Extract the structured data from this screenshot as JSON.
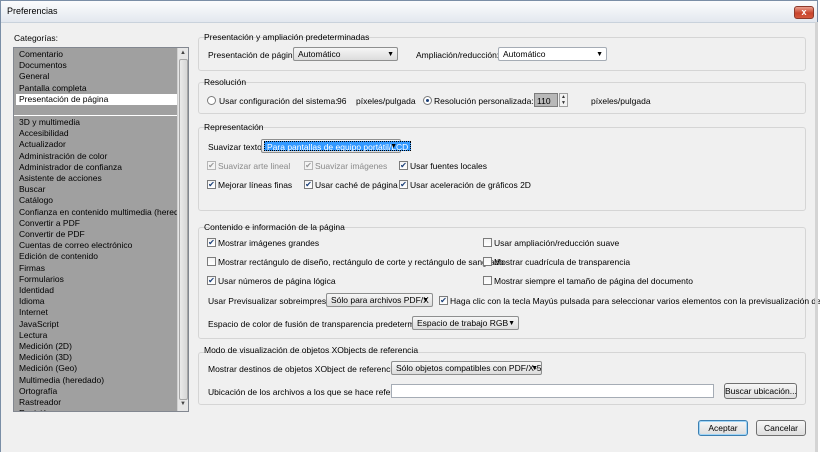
{
  "window": {
    "title": "Preferencias",
    "close_glyph": "x"
  },
  "categories": {
    "label": "Categorías:",
    "group1": [
      "Comentario",
      "Documentos",
      "General",
      "Pantalla completa",
      "Presentación de página"
    ],
    "selected": "Presentación de página",
    "group2": [
      "3D y multimedia",
      "Accesibilidad",
      "Actualizador",
      "Administración de color",
      "Administrador de confianza",
      "Asistente de acciones",
      "Buscar",
      "Catálogo",
      "Confianza en contenido multimedia (heredado)",
      "Convertir a PDF",
      "Convertir de PDF",
      "Cuentas de correo electrónico",
      "Edición de contenido",
      "Firmas",
      "Formularios",
      "Identidad",
      "Idioma",
      "Internet",
      "JavaScript",
      "Lectura",
      "Medición (2D)",
      "Medición (3D)",
      "Medición (Geo)",
      "Multimedia (heredado)",
      "Ortografía",
      "Rastreador",
      "Revisión"
    ]
  },
  "layout_section": {
    "title": "Presentación y ampliación predeterminadas",
    "page_layout_label": "Presentación de página:",
    "page_layout_value": "Automático",
    "zoom_label": "Ampliación/reducción:",
    "zoom_value": "Automático"
  },
  "resolution": {
    "title": "Resolución",
    "system_label": "Usar configuración del sistema:",
    "system_value": "96",
    "system_unit": "píxeles/pulgada",
    "custom_label": "Resolución personalizada:",
    "custom_value": "110",
    "custom_unit": "píxeles/pulgada",
    "selected": "custom"
  },
  "rendering": {
    "title": "Representación",
    "smooth_label": "Suavizar texto:",
    "smooth_value": "Para pantallas de equipo portátil/LCD",
    "smooth_lineart": "Suavizar arte lineal",
    "smooth_images": "Suavizar imágenes",
    "local_fonts": "Usar fuentes locales",
    "thin_lines": "Mejorar líneas finas",
    "page_cache": "Usar caché de página",
    "gpu_2d": "Usar aceleración de gráficos 2D",
    "check_glyph": "✔"
  },
  "content": {
    "title": "Contenido e información de la página",
    "large_images": "Mostrar imágenes grandes",
    "smooth_zoom": "Usar ampliación/reducción suave",
    "art_boxes": "Mostrar rectángulo de diseño, rectángulo de corte y rectángulo de sangrado",
    "transparency_grid": "Mostrar cuadrícula de transparencia",
    "logical_numbers": "Usar números de página lógica",
    "always_page_size": "Mostrar siempre el tamaño de página del documento",
    "overprint_label": "Usar Previsualizar sobreimpresión:",
    "overprint_value": "Sólo para archivos PDF/X",
    "shift_click": "Haga clic con la tecla Mayús pulsada para seleccionar varios elementos con la previsualización de salida",
    "blend_label": "Espacio de color de fusión de transparencia predeterminado:",
    "blend_value": "Espacio de trabajo RGB"
  },
  "xobjects": {
    "title": "Modo de visualización de objetos XObjects de referencia",
    "show_label": "Mostrar destinos de objetos XObject de referencia:",
    "show_value": "Sólo objetos compatibles con PDF/X-5",
    "location_label": "Ubicación de los archivos a los que se hace referencia:",
    "location_value": "",
    "browse": "Buscar ubicación..."
  },
  "footer": {
    "ok": "Aceptar",
    "cancel": "Cancelar"
  },
  "icons": {
    "dropdown": "▼",
    "scroll_up": "▲",
    "scroll_down": "▼",
    "spin_up": "▲",
    "spin_down": "▼"
  }
}
